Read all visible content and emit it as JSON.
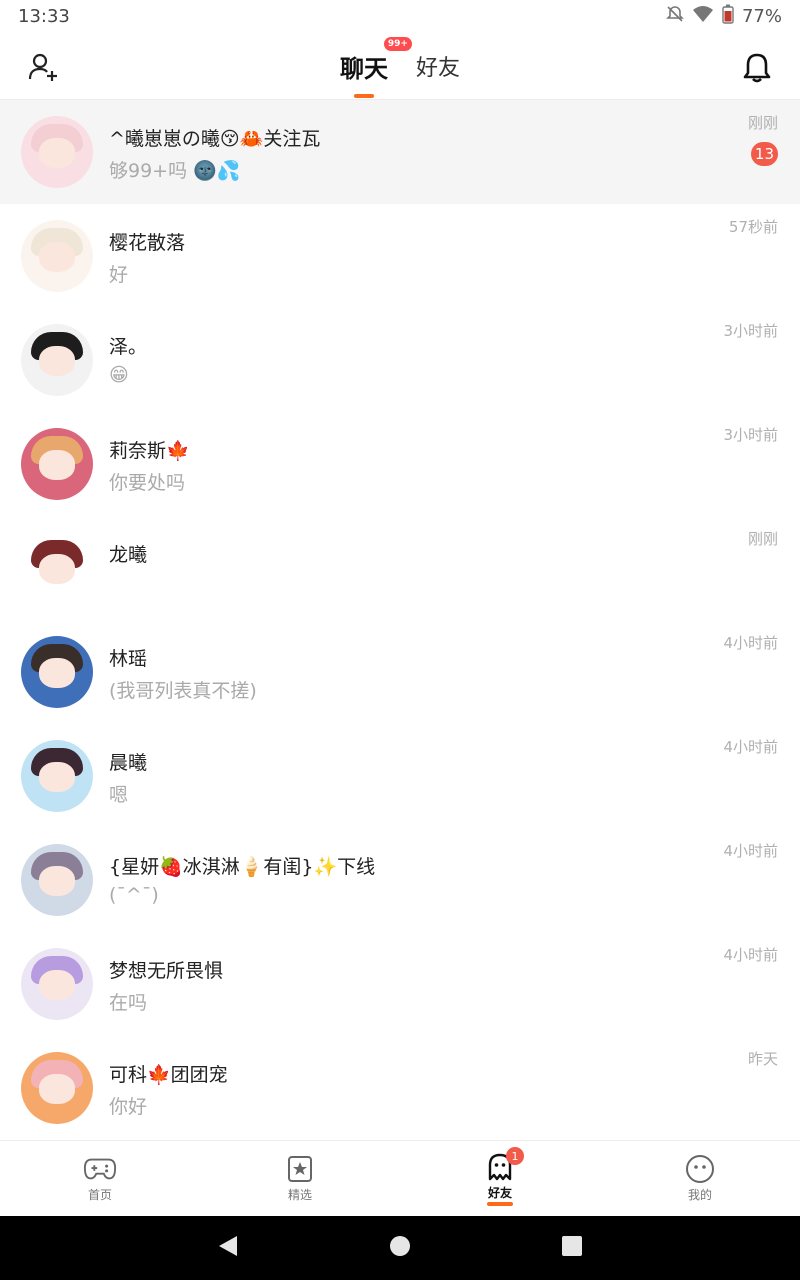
{
  "status_bar": {
    "time": "13:33",
    "battery": "77%"
  },
  "header": {
    "tabs": [
      {
        "label": "聊天",
        "badge": "99+",
        "active": true
      },
      {
        "label": "好友",
        "active": false
      }
    ]
  },
  "conversations": [
    {
      "name": "^曦崽崽の曦😚🦀关注瓦",
      "message": "够99+吗 🌚💦",
      "time": "刚刚",
      "unread": "13",
      "highlight": true,
      "hair": "#f3cfd3",
      "bg": "#f9dfe3"
    },
    {
      "name": "樱花散落",
      "message": "好",
      "time": "57秒前",
      "hair": "#f0e6d8",
      "bg": "#fbf4ee"
    },
    {
      "name": "泽。",
      "message": "😁",
      "time": "3小时前",
      "hair": "#1d1d1d",
      "bg": "#f2f2f2"
    },
    {
      "name": "莉奈斯🍁",
      "message": "你要处吗",
      "time": "3小时前",
      "hair": "#e8a86d",
      "bg": "#d9667a"
    },
    {
      "name": "龙曦",
      "message": "",
      "time": "刚刚",
      "hair": "#7a2a2a",
      "bg": "#ffffff"
    },
    {
      "name": "林瑶",
      "message": "(我哥列表真不搓)",
      "time": "4小时前",
      "hair": "#3a2e2a",
      "bg": "#3f6fb8"
    },
    {
      "name": "晨曦",
      "message": "嗯",
      "time": "4小时前",
      "hair": "#3b2833",
      "bg": "#bfe3f5"
    },
    {
      "name": "{星妍🍓冰淇淋🍦有闺}✨下线",
      "message": "(¯^¯)",
      "time": "4小时前",
      "hair": "#8a7f96",
      "bg": "#cfdae6"
    },
    {
      "name": "梦想无所畏惧",
      "message": "在吗",
      "time": "4小时前",
      "hair": "#b79ce0",
      "bg": "#ece6f4"
    },
    {
      "name": "可科🍁团团宠",
      "message": "你好",
      "time": "昨天",
      "hair": "#f3b2b6",
      "bg": "#f6a86b"
    }
  ],
  "bottom_nav": [
    {
      "label": "首页",
      "icon": "gamepad-icon",
      "active": false
    },
    {
      "label": "精选",
      "icon": "star-bookmark-icon",
      "active": false
    },
    {
      "label": "好友",
      "icon": "ghost-icon",
      "active": true,
      "badge": "1"
    },
    {
      "label": "我的",
      "icon": "face-icon",
      "active": false
    }
  ],
  "colors": {
    "accent": "#ff6a1a",
    "badge": "#f25a4a",
    "muted_text": "#aaaaaa"
  }
}
